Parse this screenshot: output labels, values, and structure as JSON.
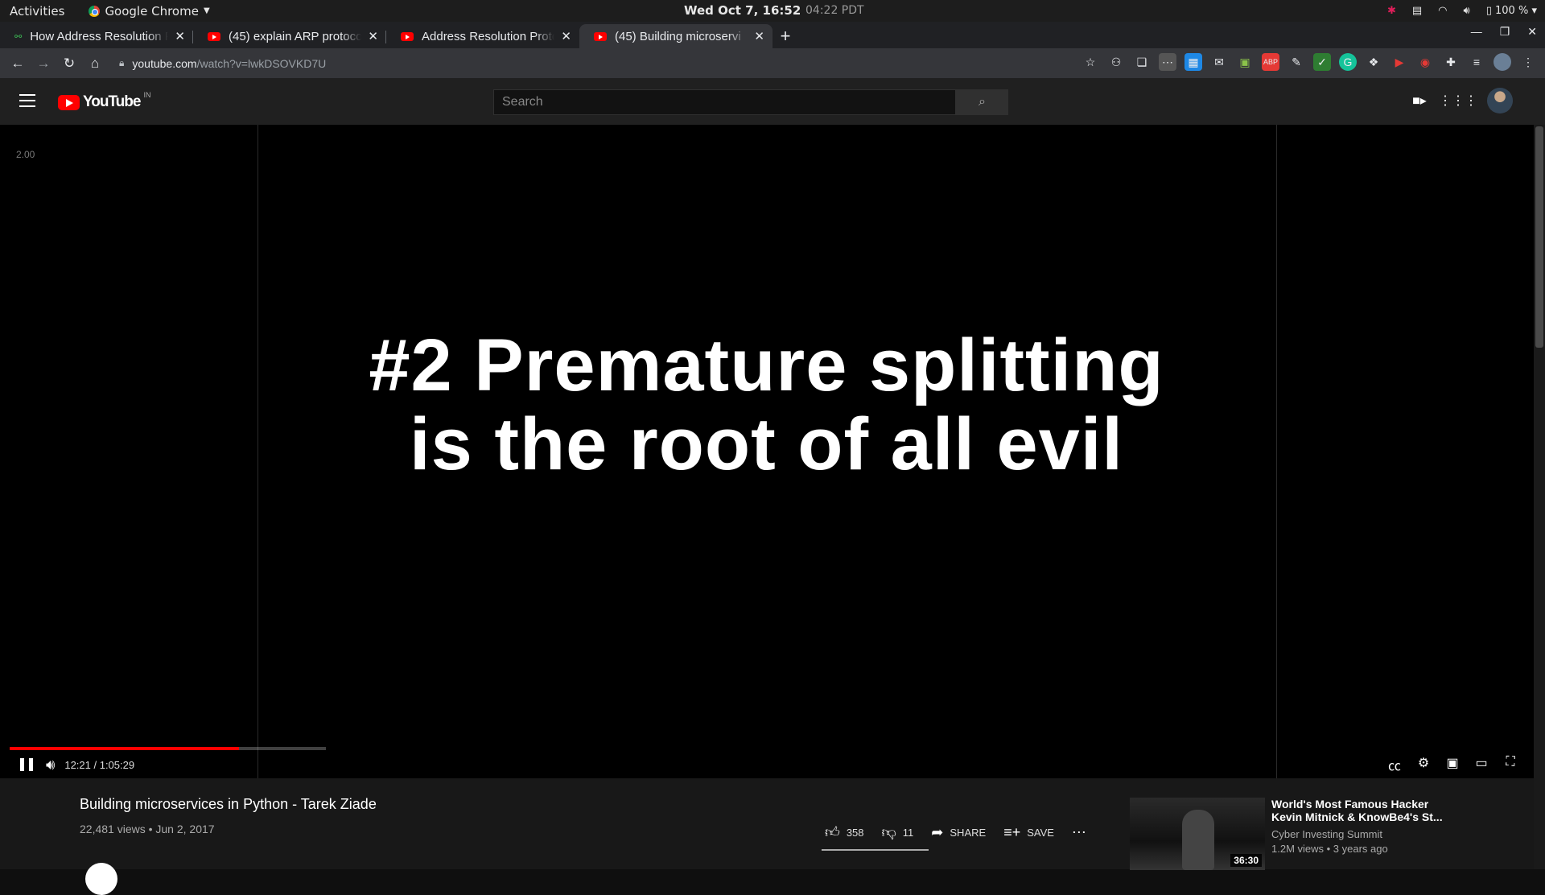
{
  "os": {
    "activities": "Activities",
    "app_name": "Google Chrome",
    "clock": "Wed Oct  7, 16:52",
    "clock_secondary": "04:22 PDT",
    "battery": "100 %"
  },
  "tabs": [
    {
      "title": "How Address Resolution P",
      "active": false
    },
    {
      "title": "(45) explain ARP protocol",
      "active": false
    },
    {
      "title": "Address Resolution Proto",
      "active": false
    },
    {
      "title": "(45) Building microservi",
      "active": true
    }
  ],
  "address_bar": {
    "domain": "youtube.com",
    "path": "/watch?v=lwkDSOVKD7U"
  },
  "youtube": {
    "logo_text": "YouTube",
    "country_code": "IN",
    "search_placeholder": "Search"
  },
  "player": {
    "speed_label": "2.00",
    "slide_line1": "#2 Premature splitting",
    "slide_line2": "is the root of all evil",
    "time_display": "12:21 / 1:05:29",
    "progress_fraction": 0.724,
    "buffer_fraction": 0.189
  },
  "video": {
    "title": "Building microservices in Python - Tarek Ziade",
    "meta": "22,481 views • Jun 2, 2017",
    "likes": "358",
    "dislikes": "11",
    "share_label": "SHARE",
    "save_label": "SAVE"
  },
  "recommended": {
    "title_line1": "World's Most Famous Hacker",
    "title_line2": "Kevin Mitnick & KnowBe4's St...",
    "channel": "Cyber Investing Summit",
    "meta": "1.2M views • 3 years ago",
    "duration": "36:30"
  }
}
